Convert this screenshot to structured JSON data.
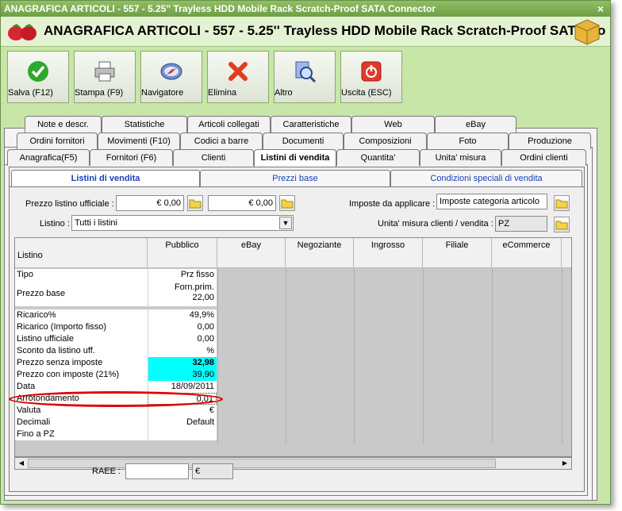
{
  "window": {
    "title": "ANAGRAFICA ARTICOLI - 557 - 5.25\" Trayless HDD Mobile Rack Scratch-Proof SATA Connector",
    "close_glyph": "×",
    "header_title": "ANAGRAFICA ARTICOLI - 557 - 5.25'' Trayless HDD Mobile Rack Scratch-Proof SATA Co"
  },
  "toolbar": {
    "save": "Salva (F12)",
    "print": "Stampa (F9)",
    "navigator": "Navigatore",
    "delete": "Elimina",
    "other": "Altro",
    "exit": "Uscita (ESC)"
  },
  "tabs_row1": [
    "Note e descr.",
    "Statistiche",
    "Articoli collegati",
    "Caratteristiche",
    "Web",
    "eBay"
  ],
  "tabs_row2": [
    "Ordini fornitori",
    "Movimenti (F10)",
    "Codici a barre",
    "Documenti",
    "Composizioni",
    "Foto",
    "Produzione"
  ],
  "tabs_row3": [
    "Anagrafica(F5)",
    "Fornitori (F6)",
    "Clienti",
    "Listini di vendita",
    "Quantita'",
    "Unita' misura",
    "Ordini clienti"
  ],
  "subtabs": [
    "Listini di vendita",
    "Prezzi base",
    "Condizioni speciali di vendita"
  ],
  "form": {
    "price_label": "Prezzo listino ufficiale :",
    "price1": "€ 0,00",
    "price2": "€ 0,00",
    "listino_label": "Listino :",
    "listino_value": "Tutti i listini",
    "tax_label": "Imposte da applicare :",
    "tax_value": "Imposte categoria articolo",
    "unit_label": "Unita' misura clienti / vendita :",
    "unit_value": "PZ"
  },
  "grid": {
    "corner": "Listino",
    "columns": [
      "Pubblico",
      "eBay",
      "Negoziante",
      "Ingrosso",
      "Filiale",
      "eCommerce"
    ],
    "rows": [
      {
        "label": "Tipo",
        "value": "Prz fisso"
      },
      {
        "label": "Prezzo base",
        "value": "Forn.prim.\n22,00"
      },
      {
        "label": "Ricarico%",
        "value": "49,9%"
      },
      {
        "label": "Ricarico (Importo fisso)",
        "value": "0,00"
      },
      {
        "label": "Listino ufficiale",
        "value": "0,00"
      },
      {
        "label": "Sconto da listino uff.",
        "value": "%"
      },
      {
        "label": "Prezzo senza imposte",
        "value": "32,98"
      },
      {
        "label": "Prezzo con imposte (21%)",
        "value": "39,90"
      },
      {
        "label": "Data",
        "value": "18/09/2011"
      },
      {
        "label": "Arrotondamento",
        "value": "0,01"
      },
      {
        "label": "Valuta",
        "value": "€"
      },
      {
        "label": "Decimali",
        "value": "Default"
      },
      {
        "label": "Fino a PZ",
        "value": ""
      }
    ]
  },
  "raee": {
    "label": "RAEE :",
    "value": "",
    "currency": "€"
  },
  "colors": {
    "frame": "#c8e6a8",
    "highlight": "#00ffff",
    "oval": "#e00000"
  }
}
